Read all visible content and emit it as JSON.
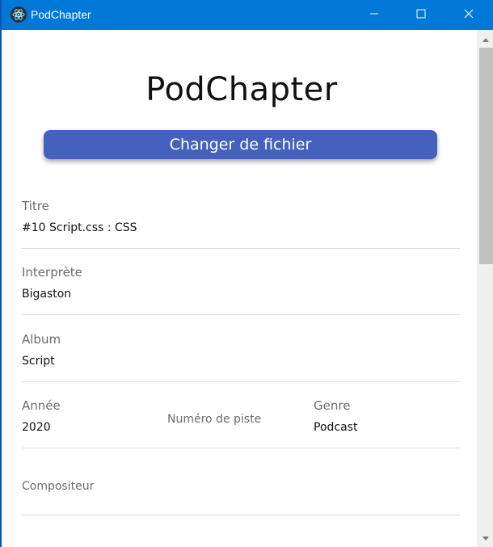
{
  "window": {
    "title": "PodChapter",
    "accent": "#0078d7"
  },
  "header": {
    "title": "PodChapter",
    "change_file_label": "Changer de fichier",
    "button_color": "#4462bd"
  },
  "fields": {
    "titre": {
      "label": "Titre",
      "value": "#10 Script.css : CSS"
    },
    "interprete": {
      "label": "Interprète",
      "value": "Bigaston"
    },
    "album": {
      "label": "Album",
      "value": "Script"
    },
    "annee": {
      "label": "Année",
      "value": "2020"
    },
    "numero_piste": {
      "label": "Numéro de piste",
      "value": ""
    },
    "genre": {
      "label": "Genre",
      "value": "Podcast"
    },
    "compositeur": {
      "label": "Compositeur",
      "value": ""
    }
  },
  "icons": {
    "app": "electron-icon",
    "minimize": "minimize-icon",
    "maximize": "maximize-icon",
    "close": "close-icon"
  }
}
